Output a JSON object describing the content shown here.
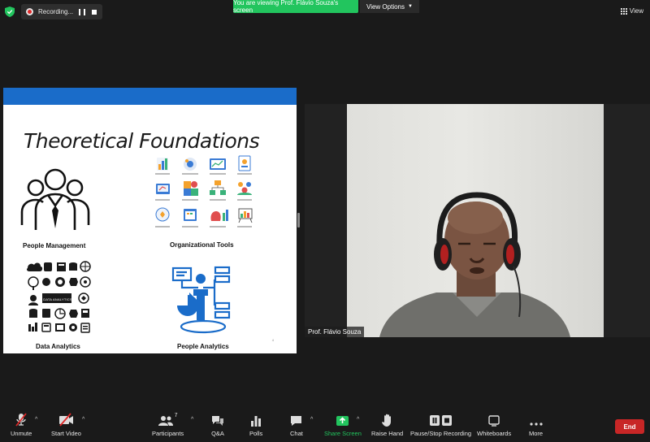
{
  "topbar": {
    "recording_label": "Recording...",
    "viewing_banner": "You are viewing Prof. Flávio Souza's screen",
    "view_options_label": "View Options",
    "view_label": "View"
  },
  "slide": {
    "title": "Theoretical Foundations",
    "captions": [
      "People Management",
      "Organizational Tools",
      "Data Analytics",
      "People Analytics"
    ],
    "data_analytics_badge": "DATA ANALYTICS",
    "page_number": "4"
  },
  "camera": {
    "participant_name": "Prof. Flávio Souza"
  },
  "toolbar": {
    "unmute": "Unmute",
    "start_video": "Start Video",
    "participants": "Participants",
    "participants_count": "7",
    "qa": "Q&A",
    "polls": "Polls",
    "chat": "Chat",
    "share_screen": "Share Screen",
    "raise_hand": "Raise Hand",
    "pause_stop_recording": "Pause/Stop Recording",
    "whiteboards": "Whiteboards",
    "more": "More",
    "end": "End"
  },
  "colors": {
    "share_green": "#22c55e",
    "end_red": "#c82626",
    "slide_blue": "#1a6cc9"
  }
}
